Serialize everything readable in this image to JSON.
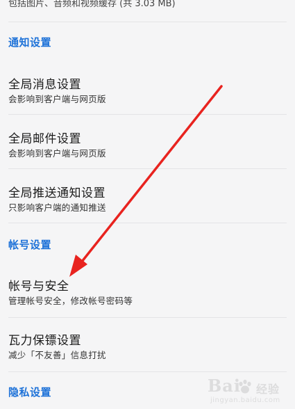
{
  "cache_info": "包括图片、音频和视频缓存 (共 3.03 MB)",
  "sections": {
    "notification": {
      "header": "通知设置",
      "items": [
        {
          "title": "全局消息设置",
          "subtitle": "会影响到客户端与网页版"
        },
        {
          "title": "全局邮件设置",
          "subtitle": "会影响到客户端与网页版"
        },
        {
          "title": "全局推送通知设置",
          "subtitle": "只影响客户端的通知推送"
        }
      ]
    },
    "account": {
      "header": "帐号设置",
      "items": [
        {
          "title": "帐号与安全",
          "subtitle": "管理帐号安全，修改帐号密码等"
        },
        {
          "title": "瓦力保镖设置",
          "subtitle": "减少「不友善」信息打扰"
        }
      ]
    },
    "privacy": {
      "header": "隐私设置"
    }
  },
  "colors": {
    "accent": "#1e72d8",
    "arrow": "#e8231f",
    "background": "#f5f5f6"
  },
  "watermark": {
    "brand": "Bai",
    "brand_suffix": "经验",
    "sub": "jingyan.baidu.com"
  }
}
